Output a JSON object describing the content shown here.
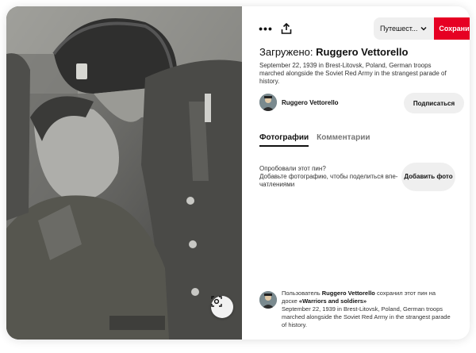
{
  "toolbar": {
    "more_label": "•••",
    "board_label": "Путешест...",
    "save_label": "Сохранить"
  },
  "pin": {
    "title_prefix": "Загружено: ",
    "title_author": "Ruggero Vettorello",
    "description": "September 22, 1939 in Brest-Litovsk, Poland, German troops marched alongside the Soviet Red Army in the strangest parade of history."
  },
  "author": {
    "name": "Ruggero Vettorello",
    "subscribe_label": "Подписаться"
  },
  "tabs": [
    {
      "label": "Фотографии",
      "active": true
    },
    {
      "label": "Комментарии",
      "active": false
    }
  ],
  "tried": {
    "line1": "Опробовали этот пин?",
    "line2": "Добавьте фотографию, чтобы поделиться впе-чатлениями",
    "button_label": "Добавить фото"
  },
  "saved": {
    "prefix": "Пользователь ",
    "user": "Ruggero Vettorello",
    "middle": " сохранил этот пин на доске ",
    "board": "«Warriors and soldiers»",
    "description": "September 22, 1939 in Brest-Litovsk, Poland, German troops marched alongside the Soviet Red Army in the strangest parade of history."
  },
  "icons": {
    "more": "more-horizontal-icon",
    "share": "share-upload-icon",
    "board_chevron": "chevron-down-icon",
    "visual_search": "visual-search-lens-icon"
  },
  "colors": {
    "accent": "#e60023",
    "button_bg": "#efefef",
    "muted_text": "#767676"
  }
}
